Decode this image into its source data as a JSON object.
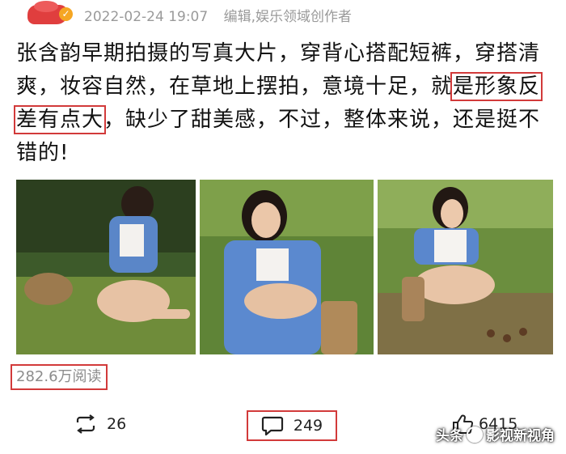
{
  "header": {
    "datetime": "2022-02-24 19:07",
    "author_role": "编辑,娱乐领域创作者"
  },
  "post": {
    "text_before": "张含韵早期拍摄的写真大片，穿背心搭配短裤，穿搭清爽，妆容自然，在草地上摆拍，意境十足，就",
    "highlight": "是形象反差有点大",
    "text_after": "，缺少了甜美感，不过，整体来说，还是挺不错的!"
  },
  "stats": {
    "read_count": "282.6万阅读"
  },
  "actions": {
    "repost_count": "26",
    "comment_count": "249",
    "like_count": "6415"
  },
  "watermark": {
    "prefix": "头条",
    "account": "影视新视角"
  },
  "colors": {
    "highlight_box": "#d23a3a",
    "meta_text": "#9a9a9a",
    "verify_badge": "#f5a623"
  },
  "icons": [
    "verified-badge-icon",
    "repost-icon",
    "comment-icon",
    "like-icon",
    "toutiao-logo-icon"
  ]
}
